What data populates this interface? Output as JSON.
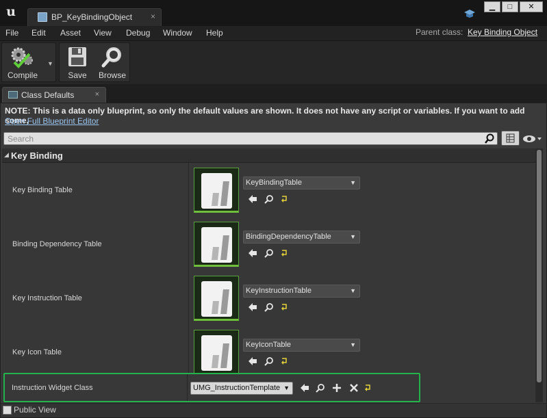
{
  "window": {
    "app_logo": "unreal-engine-logo",
    "tab_title": "BP_KeyBindingObject",
    "tab_close": "×",
    "controls": [
      "minimize",
      "maximize",
      "close"
    ]
  },
  "menu": {
    "items": [
      "File",
      "Edit",
      "Asset",
      "View",
      "Debug",
      "Window",
      "Help"
    ],
    "parent_class_label": "Parent class:",
    "parent_class_value": "Key Binding Object"
  },
  "toolbar": {
    "compile_label": "Compile",
    "save_label": "Save",
    "browse_label": "Browse"
  },
  "panel_tab": {
    "label": "Class Defaults",
    "close": "×"
  },
  "notice": {
    "text": "NOTE: This is a data only blueprint, so only the default values are shown.  It does not have any script or variables.  If you want to add some,",
    "link": "Open Full Blueprint Editor"
  },
  "search": {
    "placeholder": "Search"
  },
  "category": {
    "label": "Key Binding"
  },
  "properties": [
    {
      "label": "Key Binding Table",
      "value": "KeyBindingTable"
    },
    {
      "label": "Binding Dependency Table",
      "value": "BindingDependencyTable"
    },
    {
      "label": "Key Instruction Table",
      "value": "KeyInstructionTable"
    },
    {
      "label": "Key Icon Table",
      "value": "KeyIconTable"
    }
  ],
  "widget_class": {
    "label": "Instruction Widget Class",
    "value": "UMG_InstructionTemplate"
  },
  "public_view": {
    "label": "Public View"
  },
  "colors": {
    "highlight": "#24b24a",
    "thumbnail_accent": "#6fbe3c",
    "link": "#9cc6f0"
  }
}
